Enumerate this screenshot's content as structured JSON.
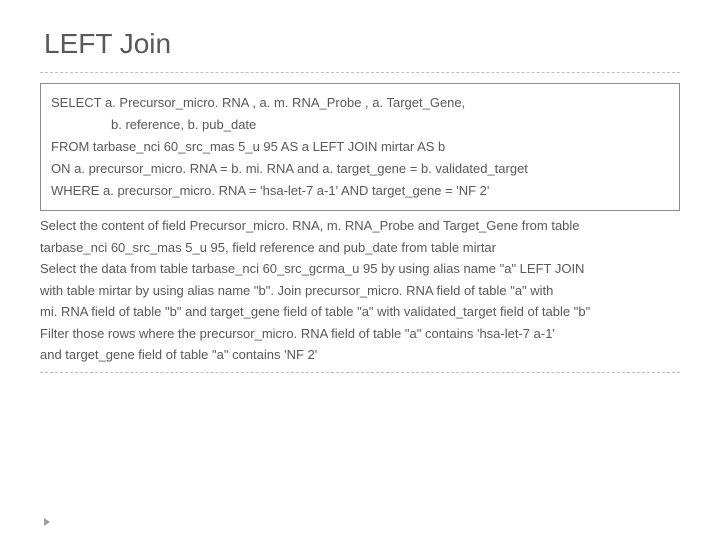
{
  "title": "LEFT Join",
  "sql": {
    "l1": "SELECT a. Precursor_micro. RNA , a. m. RNA_Probe , a. Target_Gene,",
    "l2": "b. reference, b. pub_date",
    "l3": "FROM tarbase_nci 60_src_mas 5_u 95 AS a LEFT JOIN mirtar AS b",
    "l4": "ON a. precursor_micro. RNA = b. mi. RNA and a. target_gene = b. validated_target",
    "l5": "WHERE a. precursor_micro. RNA = 'hsa-let-7 a-1' AND target_gene = 'NF 2'"
  },
  "exp": {
    "l1": "Select the content of field Precursor_micro. RNA,  m. RNA_Probe and Target_Gene from table",
    "l2": "tarbase_nci 60_src_mas 5_u 95, field reference and pub_date from table mirtar",
    "l3": "Select the data from table tarbase_nci 60_src_gcrma_u 95 by using alias name \"a\" LEFT JOIN",
    "l4": "with table mirtar by using alias name \"b\".  Join precursor_micro. RNA field of table \"a\" with",
    "l5": "mi. RNA field of table \"b\" and target_gene field of table \"a\" with validated_target field of table \"b\"",
    "l6": "Filter those rows where the precursor_micro. RNA field of table \"a\" contains 'hsa-let-7 a-1'",
    "l7": "and target_gene field of table \"a\" contains 'NF 2'"
  }
}
